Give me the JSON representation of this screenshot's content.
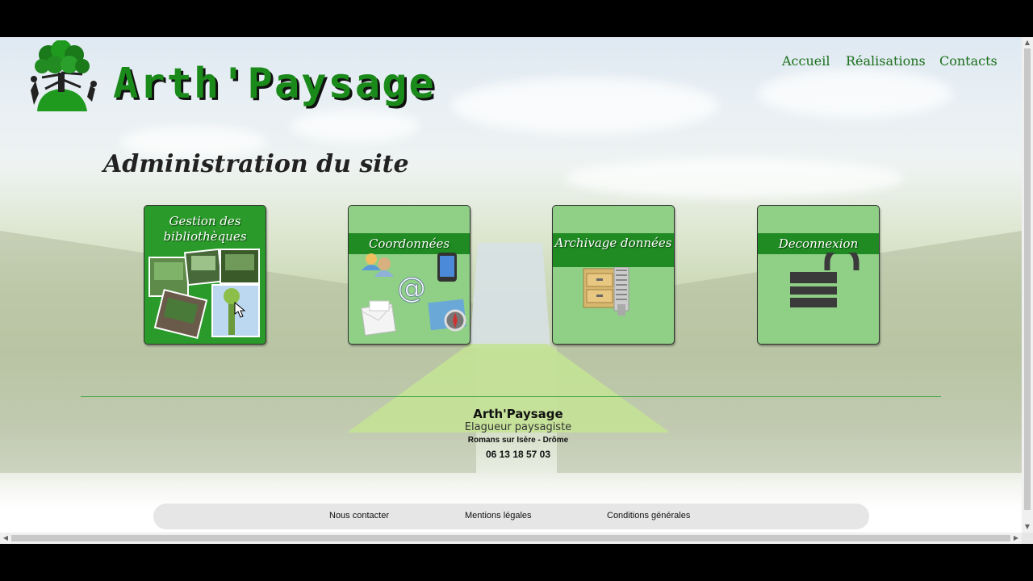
{
  "header": {
    "brand": "Arth'Paysage",
    "nav": [
      {
        "label": "Accueil"
      },
      {
        "label": "Réalisations"
      },
      {
        "label": "Contacts"
      }
    ]
  },
  "main": {
    "title": "Administration du site",
    "tiles": [
      {
        "label": "Gestion des bibliothèques",
        "icon": "photo-gallery-icon"
      },
      {
        "label": "Coordonnées",
        "icon": "contacts-icon"
      },
      {
        "label": "Archivage données",
        "icon": "archive-icon"
      },
      {
        "label": "Deconnexion",
        "icon": "unlocked-padlock-icon"
      }
    ]
  },
  "footer": {
    "name": "Arth'Paysage",
    "job": "Elagueur paysagiste",
    "city": "Romans sur Isère - Drôme",
    "phone": "06 13 18 57 03",
    "links": [
      {
        "label": "Nous contacter"
      },
      {
        "label": "Mentions légales"
      },
      {
        "label": "Conditions générales"
      }
    ]
  },
  "colors": {
    "brand_green": "#1a8a1a",
    "tile_band": "#1f8b22",
    "tile_bg": "#8fcf86"
  }
}
